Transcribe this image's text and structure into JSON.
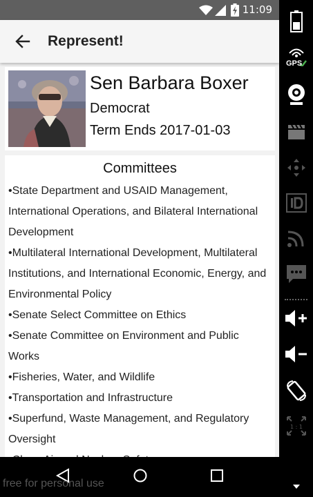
{
  "status_bar": {
    "time": "11:09"
  },
  "app_bar": {
    "title": "Represent!"
  },
  "profile": {
    "name": "Sen Barbara Boxer",
    "party": "Democrat",
    "term": "Term Ends 2017-01-03"
  },
  "committees": {
    "title": "Committees",
    "items": [
      "•State Department and USAID Management, International Operations, and Bilateral International Development",
      "•Multilateral International Development, Multilateral Institutions, and International Economic, Energy, and Environmental Policy",
      "•Senate Select Committee on Ethics",
      "•Senate Committee on Environment and Public Works",
      "•Fisheries, Water, and Wildlife",
      "•Transportation and Infrastructure",
      "•Superfund, Waste Management, and Regulatory Oversight",
      "•Clean Air and Nuclear Safety"
    ]
  },
  "watermark": "free for personal use",
  "side_panel": {
    "gps_label": "GPS",
    "scale_label": "1 : 1"
  },
  "icons": [
    "back-arrow-icon",
    "wifi-icon",
    "signal-icon",
    "battery-icon",
    "gps-icon",
    "webcam-icon",
    "video-clapper-icon",
    "dpad-icon",
    "id-icon",
    "rss-icon",
    "sms-icon",
    "volume-up-icon",
    "volume-down-icon",
    "rotate-icon",
    "scale-icon",
    "nav-back-icon",
    "nav-home-icon",
    "nav-recents-icon"
  ]
}
